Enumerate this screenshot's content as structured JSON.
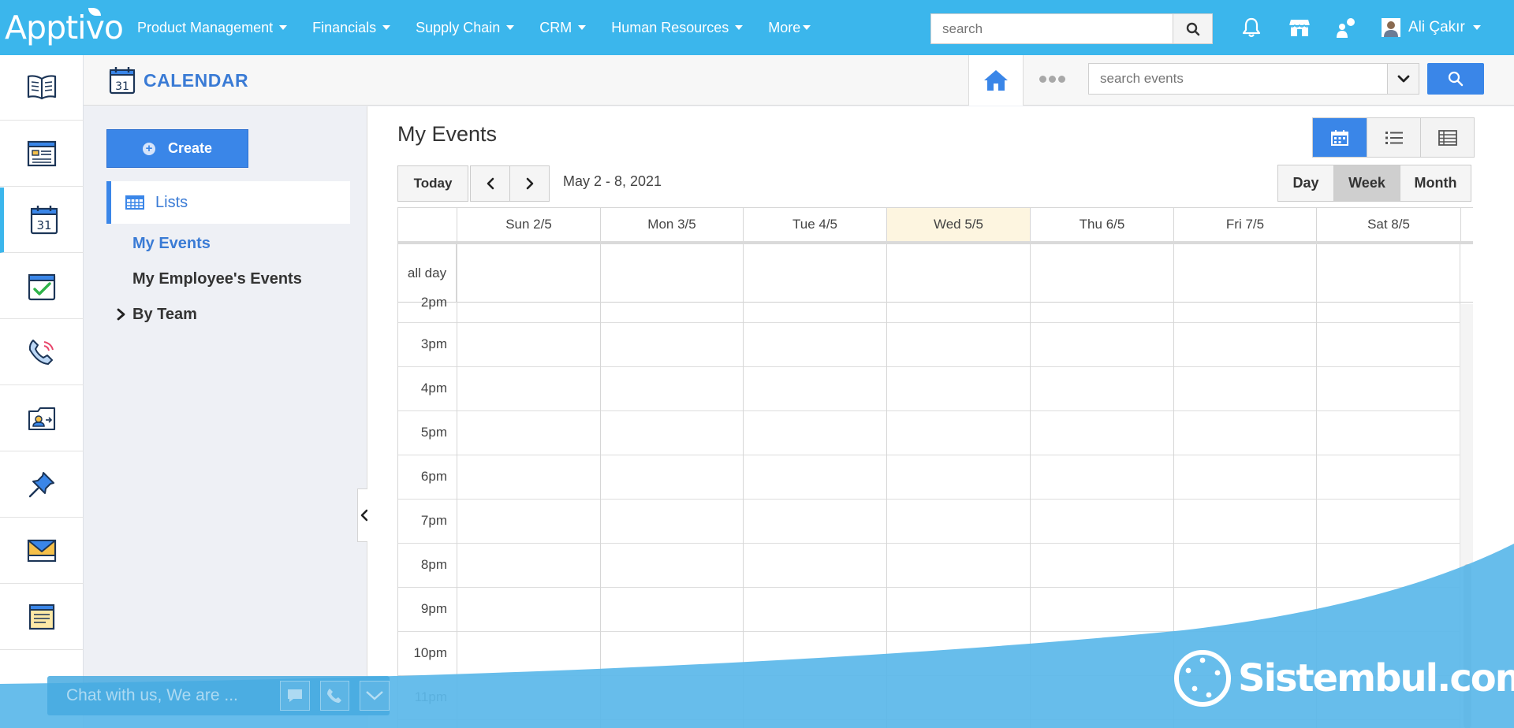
{
  "app": {
    "logo": "Apptivo"
  },
  "topnav": {
    "items": [
      "Product Management",
      "Financials",
      "Supply Chain",
      "CRM",
      "Human Resources",
      "More"
    ],
    "search_placeholder": "search",
    "user_name": "Ali Çakır"
  },
  "header": {
    "title": "CALENDAR",
    "calendar_icon_day": "31",
    "search_placeholder": "search events"
  },
  "sidebar": {
    "create_label": "Create",
    "lists_label": "Lists",
    "links": [
      "My Events",
      "My Employee's Events",
      "By Team"
    ]
  },
  "main": {
    "title": "My Events",
    "today_label": "Today",
    "date_range": "May 2 - 8, 2021",
    "views": [
      "Day",
      "Week",
      "Month"
    ],
    "active_view": "Week",
    "days": [
      "Sun 2/5",
      "Mon 3/5",
      "Tue 4/5",
      "Wed 5/5",
      "Thu 6/5",
      "Fri 7/5",
      "Sat 8/5"
    ],
    "today_day": "Wed 5/5",
    "allday_label": "all day",
    "partial_hour": "2pm",
    "hours": [
      "3pm",
      "4pm",
      "5pm",
      "6pm",
      "7pm",
      "8pm",
      "9pm",
      "10pm",
      "11pm"
    ]
  },
  "chat": {
    "text": "Chat with us, We are ..."
  },
  "watermark": {
    "text": "Sistembul.com"
  },
  "colors": {
    "brand": "#3bb6ec",
    "accent": "#3a86e8",
    "today": "#fdf5e0"
  },
  "icons": {
    "rail": [
      "book-icon",
      "form-icon",
      "calendar-icon",
      "task-icon",
      "call-icon",
      "contact-icon",
      "pin-icon",
      "mail-icon",
      "notes-icon"
    ],
    "topbar": [
      "search-icon",
      "bell-icon",
      "store-icon",
      "people-icon",
      "user-avatar-icon"
    ]
  }
}
